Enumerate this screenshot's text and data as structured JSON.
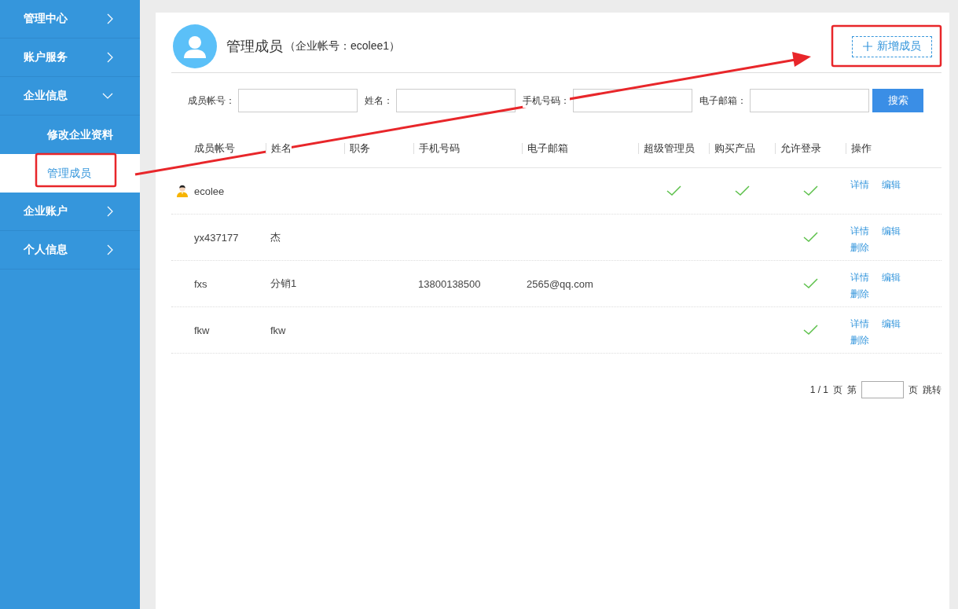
{
  "sidebar": {
    "items": [
      {
        "label": "管理中心",
        "expanded": false
      },
      {
        "label": "账户服务",
        "expanded": false
      },
      {
        "label": "企业信息",
        "expanded": true,
        "children": [
          {
            "label": "修改企业资料",
            "selected": false
          },
          {
            "label": "管理成员",
            "selected": true
          }
        ]
      },
      {
        "label": "企业账户",
        "expanded": false
      },
      {
        "label": "个人信息",
        "expanded": false
      }
    ]
  },
  "header": {
    "title": "管理成员",
    "subtitle": "（企业帐号：ecolee1）",
    "add_button": "新增成员"
  },
  "search": {
    "fields": [
      {
        "label": "成员帐号："
      },
      {
        "label": "姓名："
      },
      {
        "label": "手机号码："
      },
      {
        "label": "电子邮箱："
      }
    ],
    "button": "搜索"
  },
  "table": {
    "columns": [
      "成员帐号",
      "姓名",
      "职务",
      "手机号码",
      "电子邮箱",
      "超级管理员",
      "购买产品",
      "允许登录",
      "操作"
    ],
    "rows": [
      {
        "owner": true,
        "account": "ecolee",
        "super_admin": true,
        "buy_product": true,
        "allow_login": true,
        "actions": [
          "详情",
          "编辑"
        ]
      },
      {
        "owner": false,
        "account": "yx437177",
        "name": "杰",
        "super_admin": false,
        "buy_product": false,
        "allow_login": true,
        "actions": [
          "详情",
          "编辑",
          "删除"
        ]
      },
      {
        "owner": false,
        "account": "fxs",
        "name": "分销1",
        "phone": "13800138500",
        "email": "2565@qq.com",
        "super_admin": false,
        "buy_product": false,
        "allow_login": true,
        "actions": [
          "详情",
          "编辑",
          "删除"
        ]
      },
      {
        "owner": false,
        "account": "fkw",
        "name": "fkw",
        "super_admin": false,
        "buy_product": false,
        "allow_login": true,
        "actions": [
          "详情",
          "编辑",
          "删除"
        ]
      }
    ]
  },
  "pager": {
    "pages": "1 / 1",
    "page_label": "页",
    "go_label": "第",
    "page_unit": "页",
    "jump": "跳转"
  }
}
